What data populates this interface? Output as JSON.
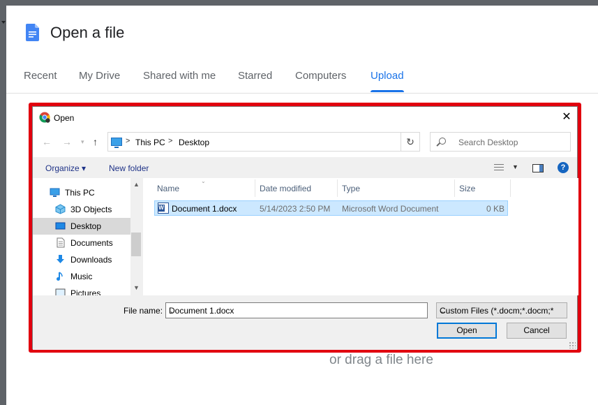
{
  "picker": {
    "title": "Open a file",
    "tabs": [
      {
        "label": "Recent"
      },
      {
        "label": "My Drive"
      },
      {
        "label": "Shared with me"
      },
      {
        "label": "Starred"
      },
      {
        "label": "Computers"
      },
      {
        "label": "Upload",
        "active": true
      }
    ],
    "drag_hint": "or drag a file here"
  },
  "dialog": {
    "title": "Open",
    "close_symbol": "✕",
    "breadcrumb": [
      "This PC",
      "Desktop"
    ],
    "search_placeholder": "Search Desktop",
    "toolbar": {
      "organize": "Organize ▾",
      "new_folder": "New folder",
      "help": "?"
    },
    "nav_items": [
      {
        "label": "This PC",
        "icon": "pc-icon"
      },
      {
        "label": "3D Objects",
        "icon": "cube-icon"
      },
      {
        "label": "Desktop",
        "icon": "desktop-icon",
        "selected": true
      },
      {
        "label": "Documents",
        "icon": "document-icon"
      },
      {
        "label": "Downloads",
        "icon": "download-icon"
      },
      {
        "label": "Music",
        "icon": "music-icon"
      },
      {
        "label": "Pictures",
        "icon": "pictures-icon"
      }
    ],
    "columns": [
      "Name",
      "Date modified",
      "Type",
      "Size"
    ],
    "files": [
      {
        "name": "Document 1.docx",
        "date": "5/14/2023 2:50 PM",
        "type": "Microsoft Word Document",
        "size": "0 KB"
      }
    ],
    "file_name_label": "File name:",
    "file_name_value": "Document 1.docx",
    "filter": "Custom Files (*.docm;*.docm;*",
    "open_button": "Open",
    "cancel_button": "Cancel"
  },
  "colors": {
    "accent": "#1a73e8",
    "highlight": "#e1000f",
    "selection": "#cce8ff"
  }
}
